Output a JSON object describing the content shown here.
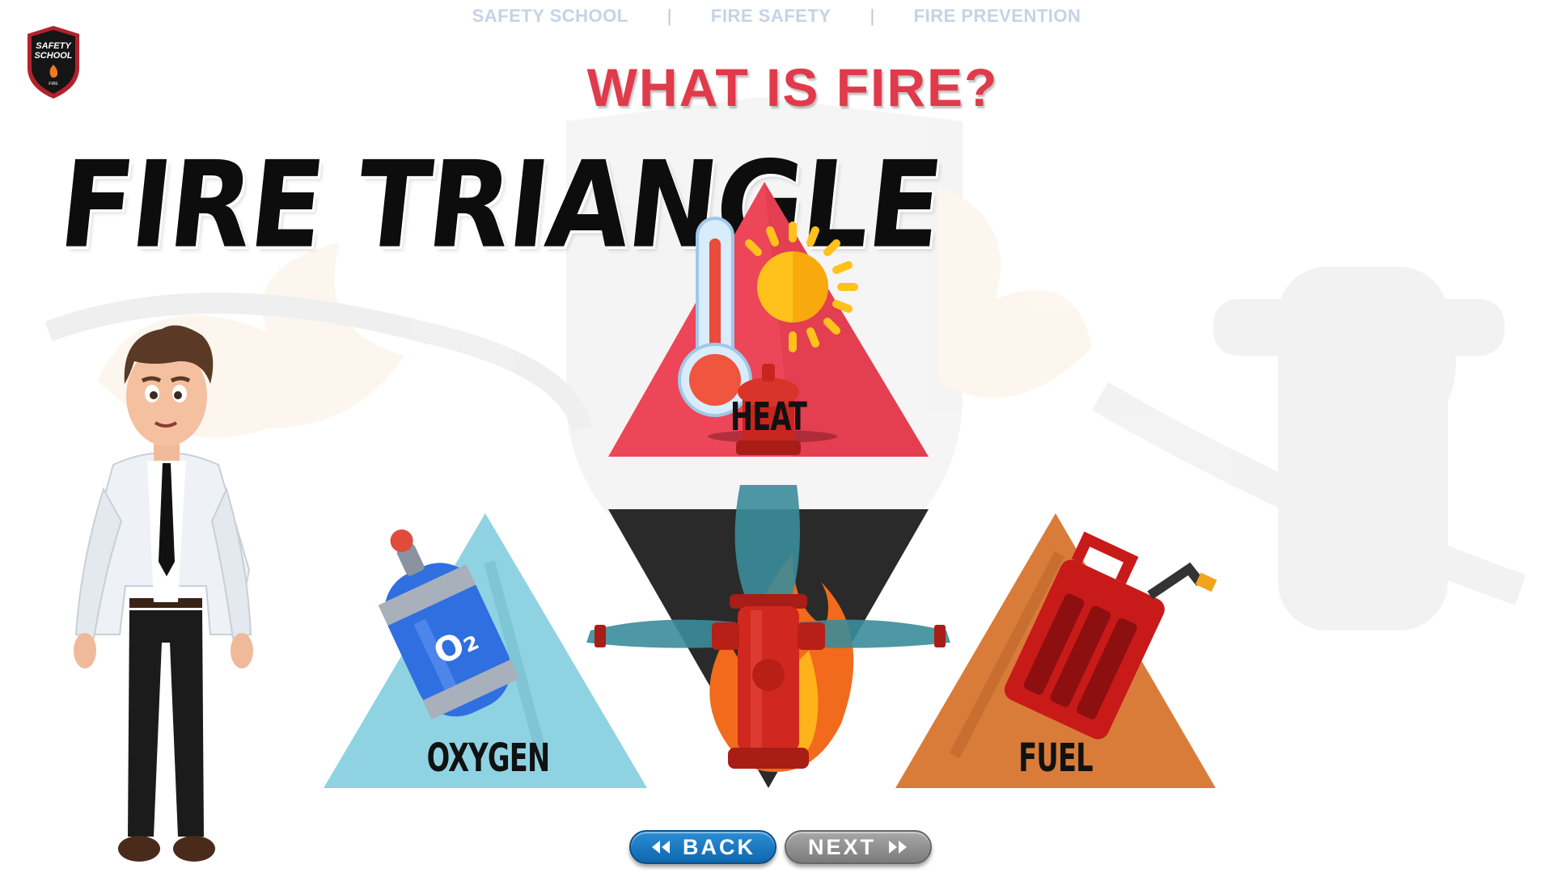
{
  "top_nav": {
    "items": [
      "SAFETY SCHOOL",
      "FIRE SAFETY",
      "FIRE PREVENTION"
    ],
    "separator": "|"
  },
  "logo": {
    "line1": "SAFETY",
    "line2": "SCHOOL",
    "line3": "FIRE"
  },
  "page_title": "WHAT IS FIRE?",
  "heading": "FIRE TRIANGLE",
  "diagram": {
    "heat": {
      "label": "HEAT",
      "color": "#ec4658",
      "icons": [
        "thermometer-icon",
        "sun-icon"
      ]
    },
    "oxygen": {
      "label": "OXYGEN",
      "color": "#8fd3e3",
      "icons": [
        "oxygen-tank-icon"
      ],
      "tank_text": "O₂"
    },
    "fuel": {
      "label": "FUEL",
      "color": "#d97c3a",
      "icons": [
        "fuel-can-icon"
      ]
    },
    "center": {
      "color": "#2a2a2a",
      "icons": [
        "flame-icon",
        "fire-hydrant-icon"
      ]
    }
  },
  "buttons": {
    "back": "BACK",
    "next": "NEXT"
  },
  "colors": {
    "title_red": "#e03a4b",
    "nav_text": "#c5d3e6",
    "back_blue": "#1a78c2",
    "next_gray": "#8c8c8c"
  }
}
